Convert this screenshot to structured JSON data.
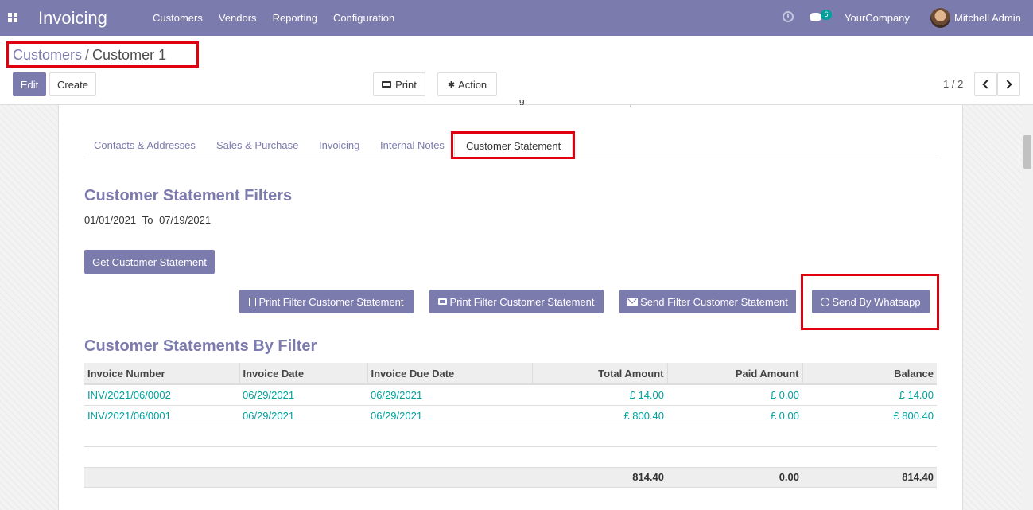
{
  "navbar": {
    "app_title": "Invoicing",
    "menu": [
      "Customers",
      "Vendors",
      "Reporting",
      "Configuration"
    ],
    "chat_count": "6",
    "company": "YourCompany",
    "user": "Mitchell Admin"
  },
  "breadcrumb": {
    "parent": "Customers",
    "separator": "/",
    "current": "Customer 1"
  },
  "toolbar": {
    "edit_label": "Edit",
    "create_label": "Create",
    "print_label": "Print",
    "action_label": "Action",
    "pager": "1 / 2"
  },
  "tabs": [
    "Contacts & Addresses",
    "Sales & Purchase",
    "Invoicing",
    "Internal Notes",
    "Customer Statement"
  ],
  "filters": {
    "heading": "Customer Statement Filters",
    "date_from": "01/01/2021",
    "to_label": "To",
    "date_to": "07/19/2021",
    "get_button": "Get Customer Statement",
    "print_xls_button": "Print Filter Customer Statement",
    "print_pdf_button": "Print Filter Customer Statement",
    "send_button": "Send Filter Customer Statement",
    "whatsapp_button": "Send By Whatsapp"
  },
  "statements": {
    "heading": "Customer Statements By Filter",
    "columns": [
      "Invoice Number",
      "Invoice Date",
      "Invoice Due Date",
      "Total Amount",
      "Paid Amount",
      "Balance"
    ],
    "rows": [
      {
        "number": "INV/2021/06/0002",
        "date": "06/29/2021",
        "due": "06/29/2021",
        "total": "£ 14.00",
        "paid": "£ 0.00",
        "balance": "£ 14.00"
      },
      {
        "number": "INV/2021/06/0001",
        "date": "06/29/2021",
        "due": "06/29/2021",
        "total": "£ 800.40",
        "paid": "£ 0.00",
        "balance": "£ 800.40"
      }
    ],
    "totals": {
      "total": "814.40",
      "paid": "0.00",
      "balance": "814.40"
    }
  },
  "colors": {
    "brand": "#7c7bad",
    "link": "#00a09d",
    "highlight": "#e0000f"
  }
}
